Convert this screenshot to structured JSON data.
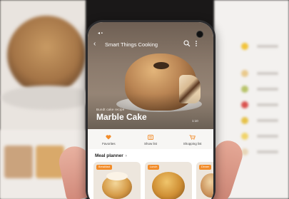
{
  "app": {
    "title": "Smart Things Cooking"
  },
  "status_bar": {
    "icons": "◂ ▪"
  },
  "recipe": {
    "kicker": "Bundt cake recipe",
    "name": "Marble Cake",
    "meta": "1:10"
  },
  "actions": [
    {
      "label": "Favorites",
      "icon": "heart-icon"
    },
    {
      "label": "Show list",
      "icon": "list-icon"
    },
    {
      "label": "Shopping list",
      "icon": "cart-icon"
    }
  ],
  "meal_planner": {
    "header": "Meal planner",
    "arrow": "›",
    "cards": [
      {
        "tag": "Breakfast"
      },
      {
        "tag": "Lunch"
      },
      {
        "tag": "Dinner"
      }
    ]
  },
  "colors": {
    "accent": "#f28c2a",
    "hero_bg": "#8b7a6c",
    "action_bar": "#f7f6f4"
  }
}
